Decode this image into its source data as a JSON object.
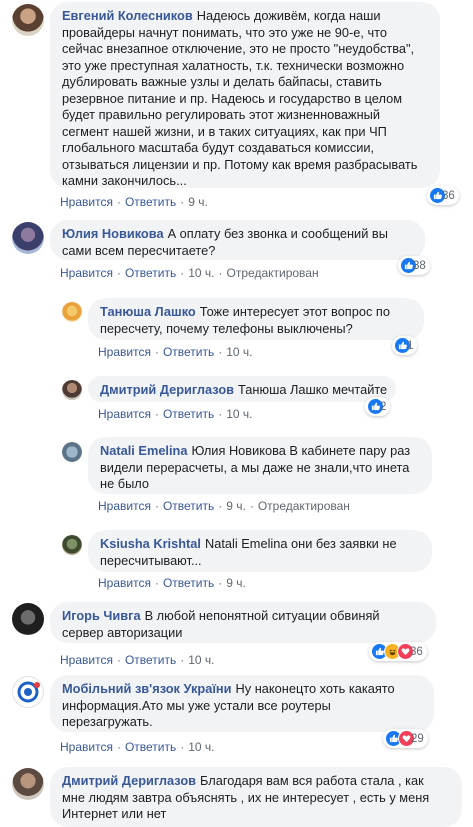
{
  "colors": {
    "link": "#385898",
    "bubble": "#f2f3f5",
    "like": "#1877f2",
    "love": "#f33e58",
    "haha": "#f7b125"
  },
  "comments": [
    {
      "author": "Евгений Колесников",
      "text": "Надеюсь доживём, когда наши провайдеры начнут понимать, что это уже не 90-е, что сейчас внезапное отключение, это не просто \"неудобства\", это уже преступная халатность, т.к. технически возможно дублировать важные узлы и делать байпасы, ставить резервное питание и пр. Надеюсь и государство в целом будет правильно регулировать этот жизненноважный сегмент нашей жизни, и в таких ситуациях, как при ЧП глобального масштаба будут создаваться комиссии, отзываться лицензии и пр. Потому как время разбрасывать камни закончилось...",
      "like": "Нравится",
      "reply": "Ответить",
      "time": "9 ч.",
      "reactions": {
        "icons": [
          "like-icon"
        ],
        "count": "36"
      }
    },
    {
      "author": "Юлия Новикова",
      "text": "А оплату без звонка и сообщений вы сами всем пересчитаете?",
      "like": "Нравится",
      "reply": "Ответить",
      "time": "10 ч.",
      "edited": "Отредактирован",
      "reactions": {
        "icons": [
          "like-icon"
        ],
        "count": "38"
      }
    },
    {
      "author": "Танюша Лашко",
      "text": "Тоже интересует этот вопрос по пересчету, почему телефоны выключены?",
      "like": "Нравится",
      "reply": "Ответить",
      "time": "10 ч.",
      "reactions": {
        "icons": [
          "like-icon"
        ],
        "count": "1"
      }
    },
    {
      "author": "Дмитрий Дериглазов",
      "text": "Танюша Лашко мечтайте",
      "like": "Нравится",
      "reply": "Ответить",
      "time": "10 ч.",
      "reactions": {
        "icons": [
          "like-icon"
        ],
        "count": "2"
      }
    },
    {
      "author": "Natali Emelina",
      "text": "Юлия Новикова В кабинете пару раз видели перерасчеты, а мы даже не знали,что инета не было",
      "like": "Нравится",
      "reply": "Ответить",
      "time": "9 ч.",
      "edited": "Отредактирован"
    },
    {
      "author": "Ksiusha Krishtal",
      "text": "Natali Emelina они без заявки не пересчитывают...",
      "like": "Нравится",
      "reply": "Ответить",
      "time": "9 ч."
    },
    {
      "author": "Игорь Чивга",
      "text": "В любой непонятной ситуации обвиняй сервер авторизации",
      "like": "Нравится",
      "reply": "Ответить",
      "time": "10 ч.",
      "reactions": {
        "icons": [
          "like-icon",
          "haha-icon",
          "love-icon"
        ],
        "count": "36"
      }
    },
    {
      "author": "Мобільний зв'язок України",
      "text": "Ну наконецто хоть какаято информация.Ато мы уже устали все роутеры перезагружать.",
      "like": "Нравится",
      "reply": "Ответить",
      "time": "10 ч.",
      "reactions": {
        "icons": [
          "like-icon",
          "love-icon"
        ],
        "count": "29"
      }
    },
    {
      "author": "Дмитрий Дериглазов",
      "text": "Благодаря вам вся работа стала , как мне людям завтра объяснять , их не интересует , есть у меня Интернет или нет"
    }
  ]
}
